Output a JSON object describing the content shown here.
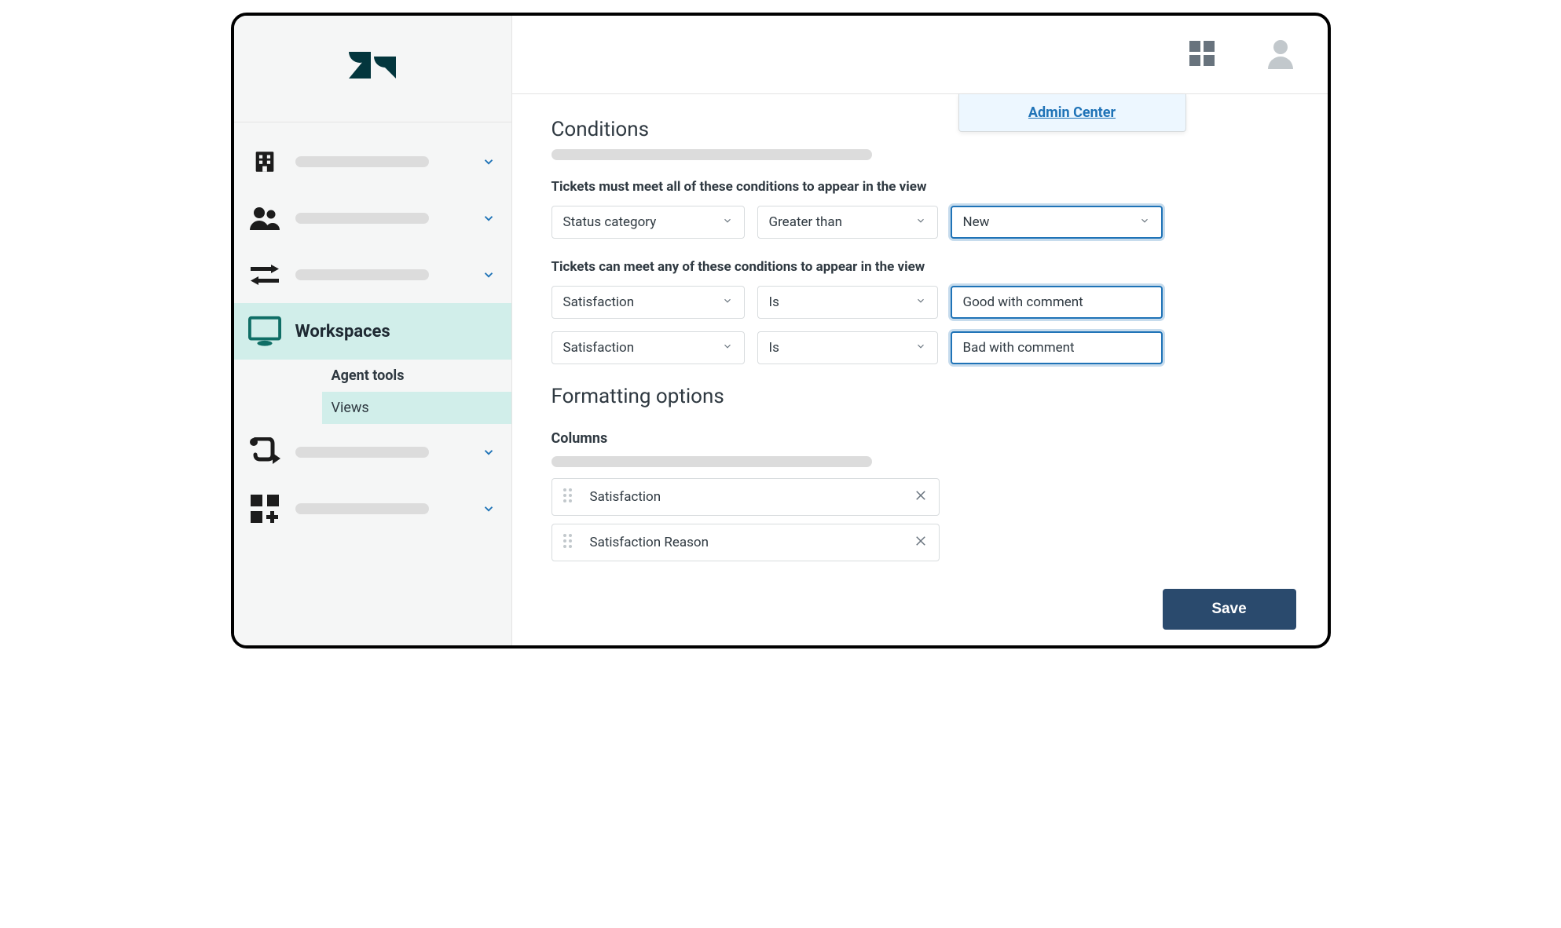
{
  "popover": {
    "label": "Admin Center"
  },
  "sidebar": {
    "items": [
      {
        "icon": "building"
      },
      {
        "icon": "people"
      },
      {
        "icon": "arrows"
      },
      {
        "icon": "workspaces",
        "label": "Workspaces",
        "subitems": [
          {
            "label": "Agent tools",
            "bold": true
          },
          {
            "label": "Views",
            "active": true
          }
        ]
      },
      {
        "icon": "flow"
      },
      {
        "icon": "apps-add"
      }
    ]
  },
  "conditions": {
    "title": "Conditions",
    "all_label": "Tickets must meet all of these conditions to appear in the view",
    "all": [
      {
        "field": "Status category",
        "operator": "Greater than",
        "value": "New",
        "value_highlight": true
      }
    ],
    "any_label": "Tickets can meet any of these conditions to appear in the view",
    "any": [
      {
        "field": "Satisfaction",
        "operator": "Is",
        "value": "Good with comment",
        "value_highlight": true
      },
      {
        "field": "Satisfaction",
        "operator": "Is",
        "value": "Bad with comment",
        "value_highlight": true
      }
    ]
  },
  "formatting": {
    "title": "Formatting options",
    "columns_label": "Columns",
    "columns": [
      {
        "label": "Satisfaction"
      },
      {
        "label": "Satisfaction Reason"
      }
    ]
  },
  "buttons": {
    "save": "Save"
  }
}
